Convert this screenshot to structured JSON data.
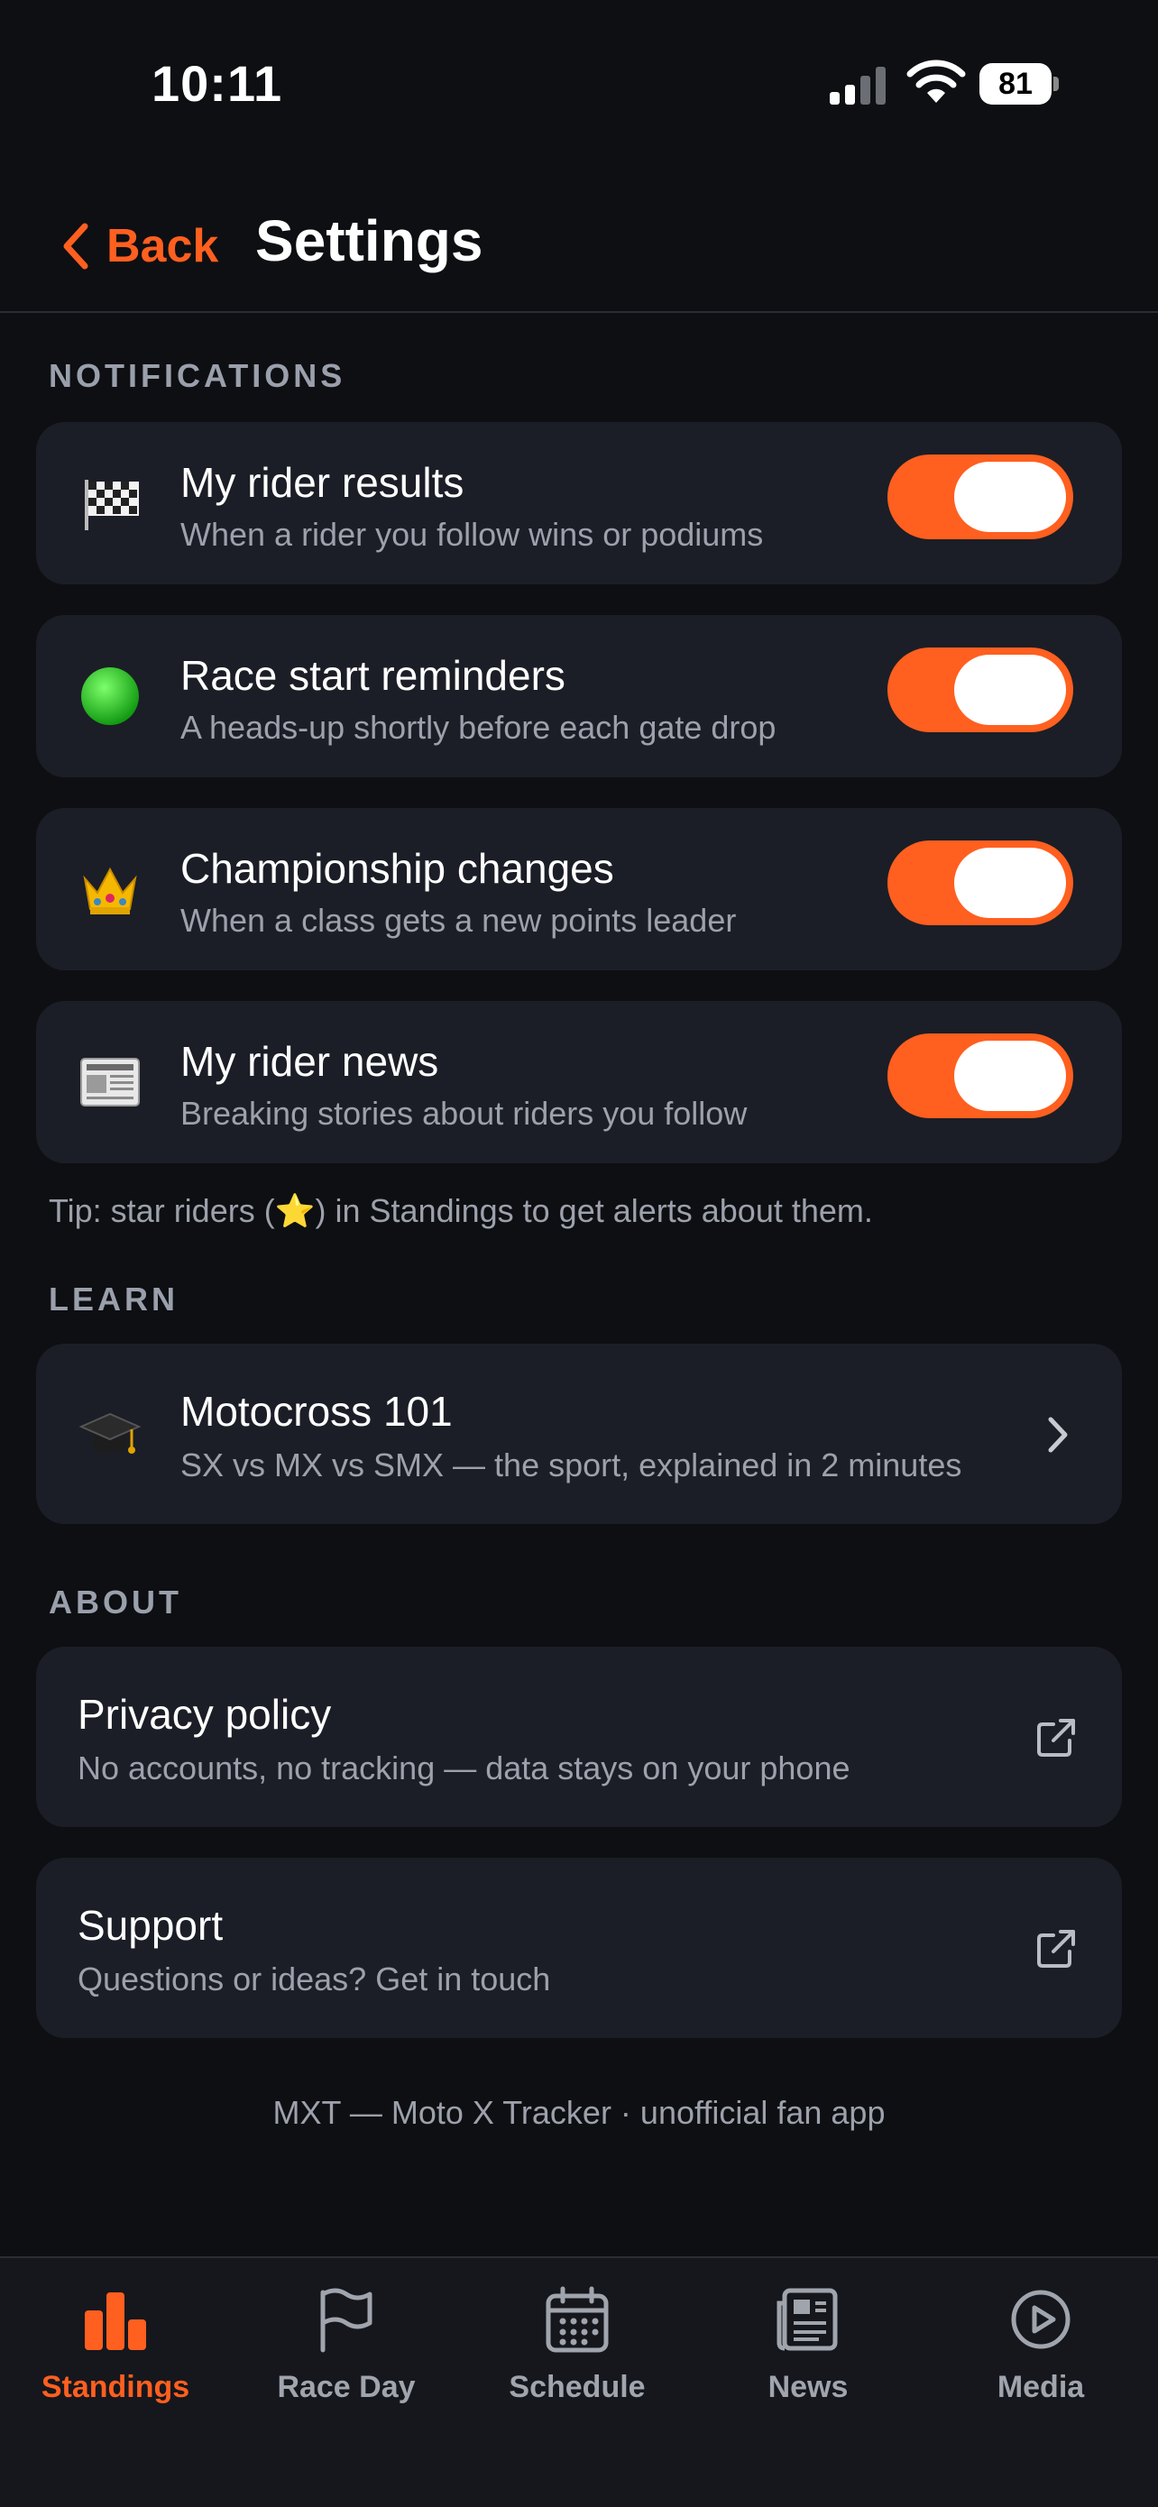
{
  "status": {
    "time": "10:11",
    "battery": "81"
  },
  "nav": {
    "back_label": "Back",
    "title": "Settings"
  },
  "notifications": {
    "section": "NOTIFICATIONS",
    "items": [
      {
        "title": "My rider results",
        "subtitle": "When a rider you follow wins or podiums",
        "icon": "checkered-flag-icon",
        "enabled": true
      },
      {
        "title": "Race start reminders",
        "subtitle": "A heads-up shortly before each gate drop",
        "icon": "green-circle-icon",
        "enabled": true
      },
      {
        "title": "Championship changes",
        "subtitle": "When a class gets a new points leader",
        "icon": "crown-icon",
        "enabled": true
      },
      {
        "title": "My rider news",
        "subtitle": "Breaking stories about riders you follow",
        "icon": "newspaper-icon",
        "enabled": true
      }
    ],
    "tip": "Tip: star riders (⭐) in Standings to get alerts about them."
  },
  "learn": {
    "section": "LEARN",
    "item": {
      "title": "Motocross 101",
      "subtitle": "SX vs MX vs SMX — the sport, explained in 2 minutes",
      "icon": "graduation-cap-icon"
    }
  },
  "about": {
    "section": "ABOUT",
    "items": [
      {
        "title": "Privacy policy",
        "subtitle": "No accounts, no tracking — data stays on your phone"
      },
      {
        "title": "Support",
        "subtitle": "Questions or ideas? Get in touch"
      }
    ]
  },
  "footer": "MXT — Moto X Tracker · unofficial fan app",
  "tabs": [
    {
      "label": "Standings",
      "icon": "bar-chart-icon",
      "active": true
    },
    {
      "label": "Race Day",
      "icon": "flag-icon",
      "active": false
    },
    {
      "label": "Schedule",
      "icon": "calendar-icon",
      "active": false
    },
    {
      "label": "News",
      "icon": "newspaper-icon",
      "active": false
    },
    {
      "label": "Media",
      "icon": "play-circle-icon",
      "active": false
    }
  ],
  "colors": {
    "accent": "#ff5f1f",
    "background": "#0e0f13",
    "card": "#1b1e26",
    "muted": "#9ca1ab"
  }
}
